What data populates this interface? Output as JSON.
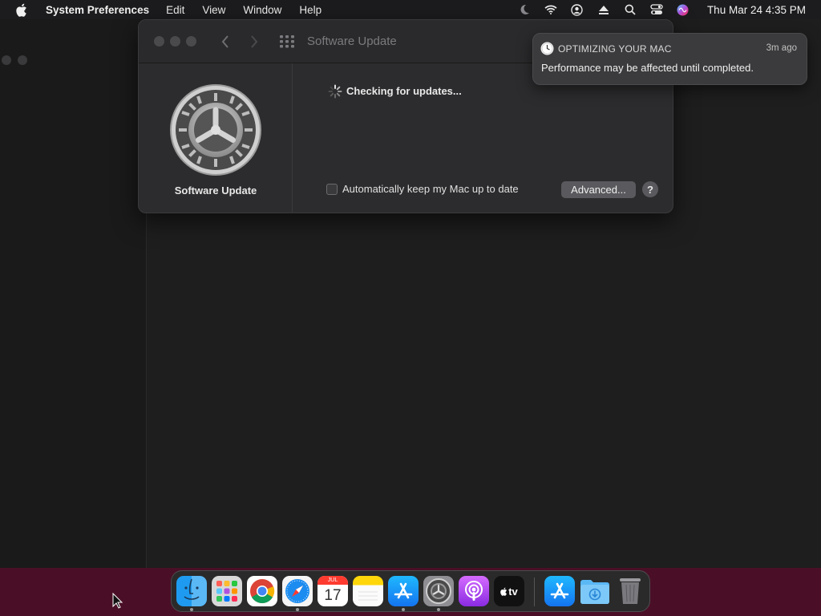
{
  "menubar": {
    "app_name": "System Preferences",
    "menus": [
      "Edit",
      "View",
      "Window",
      "Help"
    ],
    "clock": "Thu Mar 24  4:35 PM",
    "status_icons": [
      "moon-icon",
      "wifi-icon",
      "user-icon",
      "eject-icon",
      "search-icon",
      "control-center-icon",
      "siri-icon"
    ]
  },
  "window": {
    "title": "Software Update",
    "panel_label": "Software Update",
    "status_text": "Checking for updates...",
    "auto_update_label": "Automatically keep my Mac up to date",
    "auto_update_checked": false,
    "advanced_label": "Advanced...",
    "help_label": "?"
  },
  "notification": {
    "app": "OPTIMIZING YOUR MAC",
    "time": "3m ago",
    "body": "Performance may be affected until completed."
  },
  "dock": {
    "items": [
      "Finder",
      "Launchpad",
      "Google Chrome",
      "Safari",
      "Calendar",
      "Notes",
      "App Store",
      "System Preferences",
      "Podcasts",
      "TV",
      "App Store",
      "Downloads",
      "Trash"
    ],
    "calendar": {
      "month": "JUL",
      "day": "17"
    },
    "tv_label": "tv"
  },
  "colors": {
    "desktop": "#4a0f26",
    "window_bg": "#2c2c2e",
    "button": "#5a5a5e",
    "notification_bg": "#3b3b3d"
  }
}
